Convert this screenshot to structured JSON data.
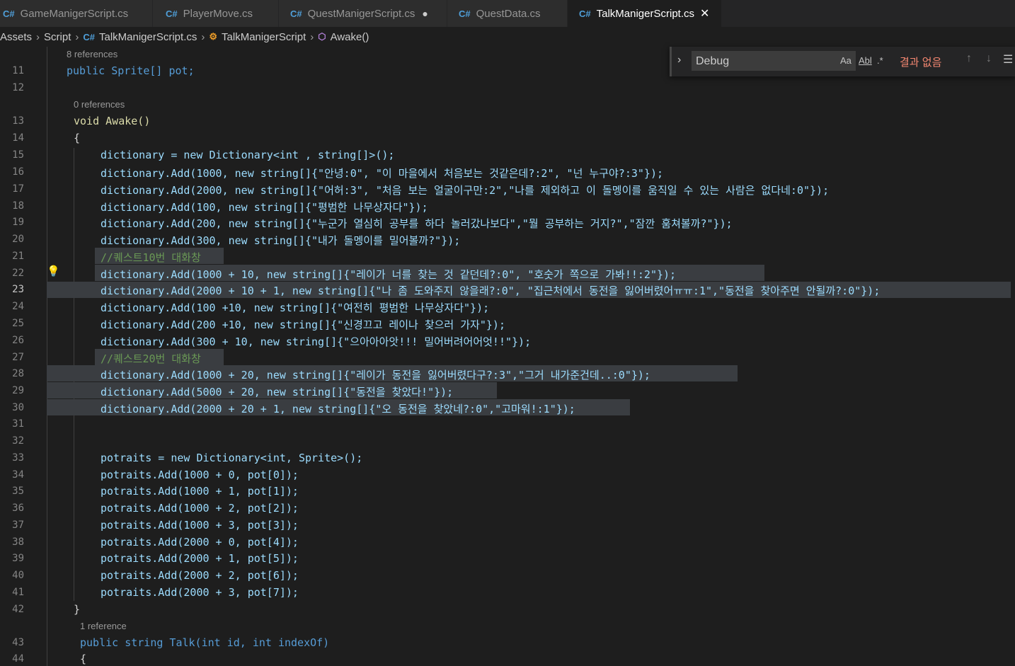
{
  "tabs": [
    {
      "label": "GameManigerScript.cs",
      "modified": false
    },
    {
      "label": "PlayerMove.cs",
      "modified": false
    },
    {
      "label": "QuestManigerScript.cs",
      "modified": true
    },
    {
      "label": "QuestData.cs",
      "modified": false
    },
    {
      "label": "TalkManigerScript.cs",
      "active": true
    }
  ],
  "breadcrumb": [
    "Assets",
    "Script",
    "TalkManigerScript.cs",
    "TalkManigerScript",
    "Awake()"
  ],
  "find": {
    "query": "Debug",
    "opt_case": "Aa",
    "opt_word": "Abl",
    "opt_regex": ".*",
    "result": "결과 없음"
  },
  "codelens": {
    "refs8": "8 references",
    "refs0": "0 references",
    "refs1": "1 reference"
  },
  "line_numbers": [
    "11",
    "12",
    "13",
    "14",
    "15",
    "16",
    "17",
    "18",
    "19",
    "20",
    "21",
    "22",
    "23",
    "24",
    "25",
    "26",
    "27",
    "28",
    "29",
    "30",
    "31",
    "32",
    "33",
    "34",
    "35",
    "36",
    "37",
    "38",
    "39",
    "40",
    "41",
    "42",
    "43",
    "44"
  ],
  "current_line": "23",
  "code": {
    "l11": "public Sprite[] pot;",
    "l13": "void Awake()",
    "l14": "{",
    "l15": "dictionary = new Dictionary<int , string[]>();",
    "l16": "dictionary.Add(1000, new string[]{\"안녕:0\", \"이 마을에서 처음보는 것같은데?:2\", \"넌 누구야?:3\"});",
    "l17": "dictionary.Add(2000, new string[]{\"어허:3\", \"처음 보는 얼굴이구만:2\",\"나를 제외하고 이 돌멩이를 움직일 수 있는 사람은 없다네:0\"});",
    "l18": "dictionary.Add(100, new string[]{\"평범한 나무상자다\"});",
    "l19": "dictionary.Add(200, new string[]{\"누군가 열심히 공부를 하다 놀러갔나보다\",\"뭘 공부하는 거지?\",\"잠깐 훔쳐볼까?\"});",
    "l20": "dictionary.Add(300, new string[]{\"내가 돌멩이를 밀어볼까?\"});",
    "l21": "//퀘스트10번 대화창",
    "l22": "dictionary.Add(1000 + 10, new string[]{\"레이가 너를 찾는 것 같던데?:0\", \"호숫가 쪽으로 가봐!!:2\"});",
    "l23": "dictionary.Add(2000 + 10 + 1, new string[]{\"나 좀 도와주지 않을래?:0\", \"집근처에서 동전을 잃어버렸어ㅠㅠ:1\",\"동전을 찾아주면 안될까?:0\"});",
    "l24": "dictionary.Add(100 +10, new string[]{\"여전히 평범한 나무상자다\"});",
    "l25": "dictionary.Add(200 +10, new string[]{\"신경끄고 레이나 찾으러 가자\"});",
    "l26": "dictionary.Add(300 + 10, new string[]{\"으아아아앗!!! 밀어버려어어엇!!\"});",
    "l27": "//퀘스트20번 대화창",
    "l28": "dictionary.Add(1000 + 20, new string[]{\"레이가 동전을 잃어버렸다구?:3\",\"그거 내가준건데..:0\"});",
    "l29": "dictionary.Add(5000 + 20, new string[]{\"동전을 찾았다!\"});",
    "l30": "dictionary.Add(2000 + 20 + 1, new string[]{\"오 동전을 찾았네?:0\",\"고마워!:1\"});",
    "l33": "potraits = new Dictionary<int, Sprite>();",
    "l34": "potraits.Add(1000 + 0, pot[0]);",
    "l35": "potraits.Add(1000 + 1, pot[1]);",
    "l36": "potraits.Add(1000 + 2, pot[2]);",
    "l37": "potraits.Add(1000 + 3, pot[3]);",
    "l38": "potraits.Add(2000 + 0, pot[4]);",
    "l39": "potraits.Add(2000 + 1, pot[5]);",
    "l40": "potraits.Add(2000 + 2, pot[6]);",
    "l41": "potraits.Add(2000 + 3, pot[7]);",
    "l42": "}",
    "l43": "public string Talk(int id, int indexOf)",
    "l44": "{"
  },
  "colors": {
    "keyword": "#569cd6",
    "type": "#4ec9b0",
    "function": "#dcdcaa",
    "variable": "#9cdcfe",
    "string": "#ce9178",
    "number": "#b5cea8",
    "comment": "#6a9955",
    "selection": "#3a3d41",
    "no_result": "#f48771"
  }
}
